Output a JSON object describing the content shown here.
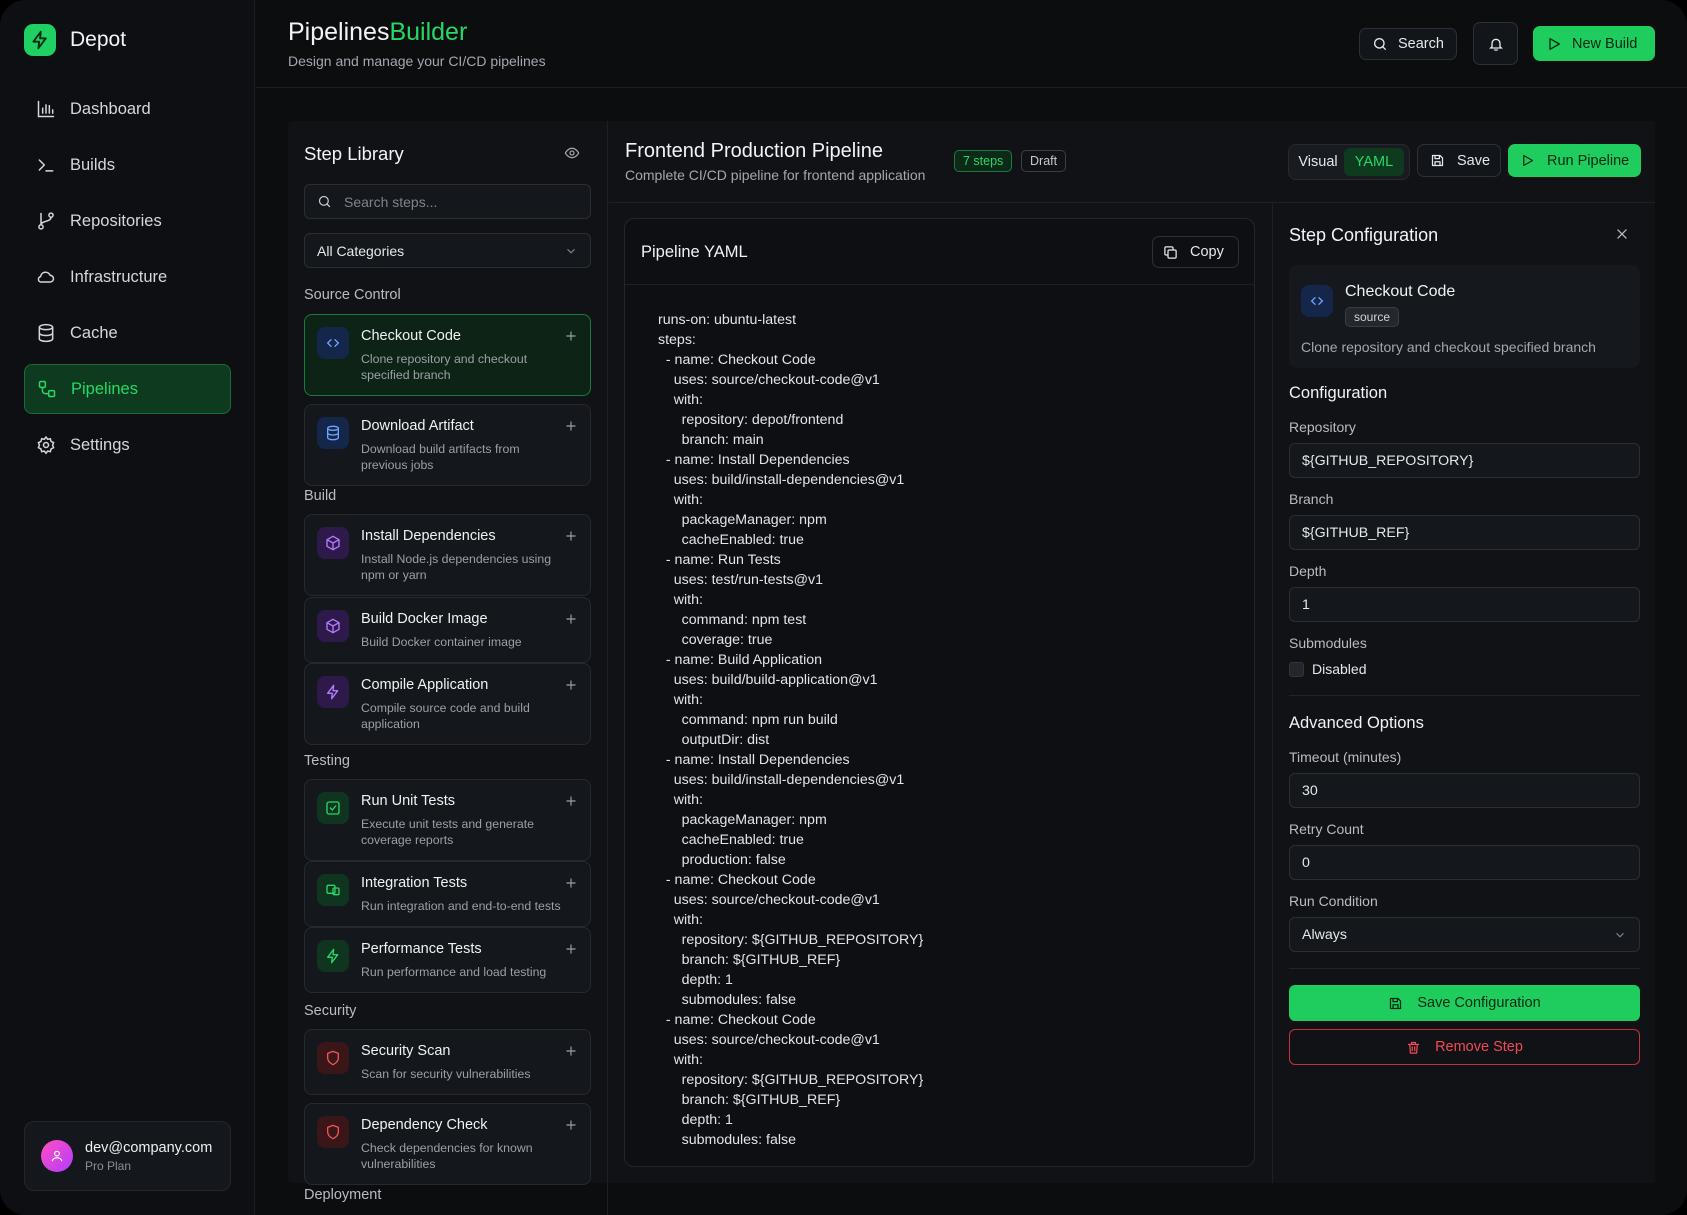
{
  "brand": {
    "name": "Depot"
  },
  "nav": [
    {
      "label": "Dashboard",
      "icon": "bar-chart-icon"
    },
    {
      "label": "Builds",
      "icon": "terminal-icon"
    },
    {
      "label": "Repositories",
      "icon": "git-branch-icon"
    },
    {
      "label": "Infrastructure",
      "icon": "cloud-icon"
    },
    {
      "label": "Cache",
      "icon": "database-icon"
    },
    {
      "label": "Pipelines",
      "icon": "workflow-icon",
      "active": true
    },
    {
      "label": "Settings",
      "icon": "gear-icon"
    }
  ],
  "user": {
    "email": "dev@company.com",
    "plan": "Pro Plan"
  },
  "header": {
    "title": "Pipelines",
    "title_accent": "Builder",
    "subtitle": "Design and manage your CI/CD pipelines",
    "search_label": "Search",
    "new_build_label": "New Build"
  },
  "library": {
    "title": "Step Library",
    "search_placeholder": "Search steps...",
    "category_filter": "All Categories",
    "categories": {
      "source": "Source Control",
      "build": "Build",
      "testing": "Testing",
      "security": "Security",
      "deployment": "Deployment"
    },
    "steps": [
      {
        "name": "Checkout Code",
        "desc": "Clone repository and checkout specified branch",
        "icon": "code-icon"
      },
      {
        "name": "Download Artifact",
        "desc": "Download build artifacts from previous jobs",
        "icon": "database-icon"
      },
      {
        "name": "Install Dependencies",
        "desc": "Install Node.js dependencies using npm or yarn",
        "icon": "package-icon"
      },
      {
        "name": "Build Docker Image",
        "desc": "Build Docker container image",
        "icon": "package-icon"
      },
      {
        "name": "Compile Application",
        "desc": "Compile source code and build application",
        "icon": "lightning-icon"
      },
      {
        "name": "Run Unit Tests",
        "desc": "Execute unit tests and generate coverage reports",
        "icon": "check-square-icon"
      },
      {
        "name": "Integration Tests",
        "desc": "Run integration and end-to-end tests",
        "icon": "devices-icon"
      },
      {
        "name": "Performance Tests",
        "desc": "Run performance and load testing",
        "icon": "lightning-icon"
      },
      {
        "name": "Security Scan",
        "desc": "Scan for security vulnerabilities",
        "icon": "shield-icon"
      },
      {
        "name": "Dependency Check",
        "desc": "Check dependencies for known vulnerabilities",
        "icon": "shield-icon"
      }
    ]
  },
  "pipeline": {
    "name": "Frontend Production Pipeline",
    "description": "Complete CI/CD pipeline for frontend application",
    "steps_badge": "7 steps",
    "status_badge": "Draft",
    "view_visual": "Visual",
    "view_yaml": "YAML",
    "save_label": "Save",
    "run_label": "Run Pipeline"
  },
  "yaml": {
    "title": "Pipeline YAML",
    "copy_label": "Copy",
    "code": "runs-on: ubuntu-latest\nsteps:\n  - name: Checkout Code\n    uses: source/checkout-code@v1\n    with:\n      repository: depot/frontend\n      branch: main\n  - name: Install Dependencies\n    uses: build/install-dependencies@v1\n    with:\n      packageManager: npm\n      cacheEnabled: true\n  - name: Run Tests\n    uses: test/run-tests@v1\n    with:\n      command: npm test\n      coverage: true\n  - name: Build Application\n    uses: build/build-application@v1\n    with:\n      command: npm run build\n      outputDir: dist\n  - name: Install Dependencies\n    uses: build/install-dependencies@v1\n    with:\n      packageManager: npm\n      cacheEnabled: true\n      production: false\n  - name: Checkout Code\n    uses: source/checkout-code@v1\n    with:\n      repository: ${GITHUB_REPOSITORY}\n      branch: ${GITHUB_REF}\n      depth: 1\n      submodules: false\n  - name: Checkout Code\n    uses: source/checkout-code@v1\n    with:\n      repository: ${GITHUB_REPOSITORY}\n      branch: ${GITHUB_REF}\n      depth: 1\n      submodules: false"
  },
  "config": {
    "title": "Step Configuration",
    "step_name": "Checkout Code",
    "step_category": "source",
    "step_desc": "Clone repository and checkout specified branch",
    "section_config": "Configuration",
    "repository_label": "Repository",
    "repository_value": "${GITHUB_REPOSITORY}",
    "branch_label": "Branch",
    "branch_value": "${GITHUB_REF}",
    "depth_label": "Depth",
    "depth_value": "1",
    "submodules_label": "Submodules",
    "submodules_value": "Disabled",
    "section_advanced": "Advanced Options",
    "timeout_label": "Timeout (minutes)",
    "timeout_value": "30",
    "retry_label": "Retry Count",
    "retry_value": "0",
    "condition_label": "Run Condition",
    "condition_value": "Always",
    "save_label": "Save Configuration",
    "remove_label": "Remove Step"
  },
  "colors": {
    "accent": "#1fcd5f",
    "danger": "#f04a55",
    "background": "#0b0d0f"
  }
}
